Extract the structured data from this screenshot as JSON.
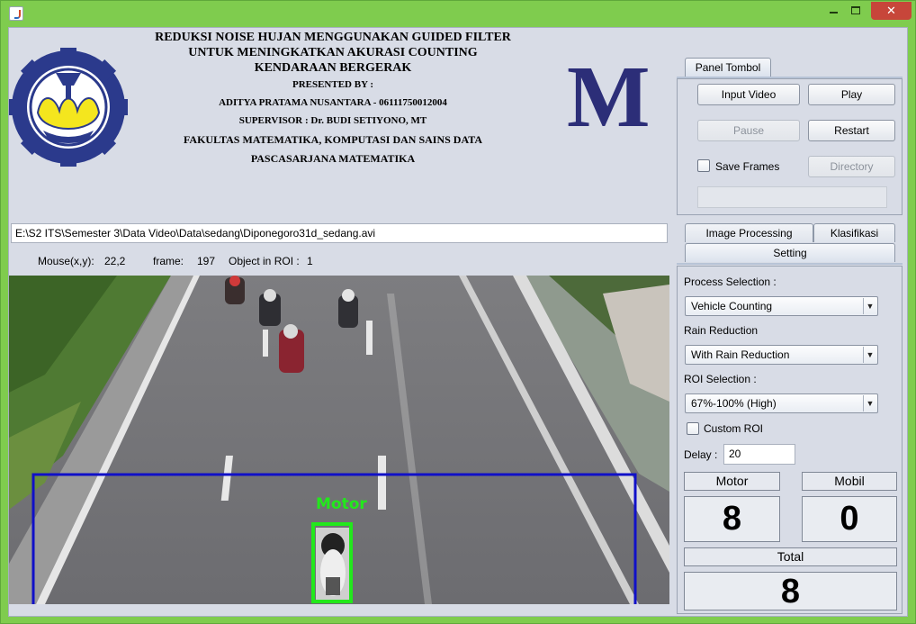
{
  "header": {
    "title_line1": "REDUKSI NOISE HUJAN MENGGUNAKAN GUIDED FILTER",
    "title_line2": "UNTUK MENINGKATKAN AKURASI COUNTING",
    "title_line3": "KENDARAAN BERGERAK",
    "presented_by": "PRESENTED BY :",
    "author": "ADITYA PRATAMA NUSANTARA - 06111750012004",
    "supervisor": "SUPERVISOR : Dr. BUDI SETIYONO, MT",
    "faculty": "FAKULTAS MATEMATIKA, KOMPUTASI DAN SAINS DATA",
    "program": "PASCASARJANA MATEMATIKA",
    "brand_letter": "M"
  },
  "file_path": "E:\\S2 ITS\\Semester 3\\Data Video\\Data\\sedang\\Diponegoro31d_sedang.avi",
  "status": {
    "mouse_label": "Mouse(x,y):",
    "mouse_value": "22,2",
    "frame_label": "frame:",
    "frame_value": "197",
    "roi_label": "Object in ROI :",
    "roi_value": "1"
  },
  "video": {
    "detection_label": "Motor",
    "roi_color": "#1010c8",
    "detection_color": "#22e81c"
  },
  "panel_tombol": {
    "tab_label": "Panel Tombol",
    "input_video": "Input Video",
    "play": "Play",
    "pause": "Pause",
    "restart": "Restart",
    "save_frames": "Save Frames",
    "directory": "Directory"
  },
  "tabs": {
    "image_processing": "Image Processing",
    "klasifikasi": "Klasifikasi",
    "setting": "Setting"
  },
  "setting": {
    "process_label": "Process Selection :",
    "process_value": "Vehicle Counting",
    "rain_label": "Rain Reduction",
    "rain_value": "With Rain Reduction",
    "roi_label": "ROI Selection :",
    "roi_value": "67%-100% (High)",
    "custom_roi": "Custom ROI",
    "delay_label": "Delay :",
    "delay_value": "20"
  },
  "counts": {
    "motor_label": "Motor",
    "motor_value": "8",
    "mobil_label": "Mobil",
    "mobil_value": "0",
    "total_label": "Total",
    "total_value": "8"
  }
}
